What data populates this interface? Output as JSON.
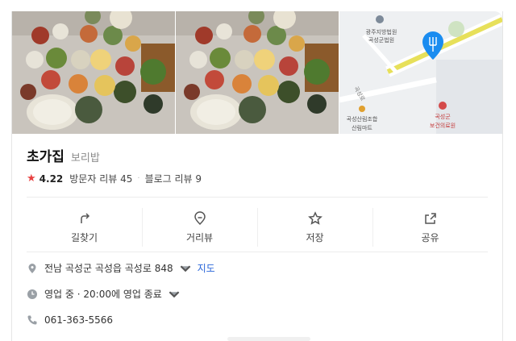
{
  "place": {
    "name": "초가집",
    "category": "보리밥",
    "rating": "4.22",
    "visitor_reviews": "방문자 리뷰 45",
    "blog_reviews": "블로그 리뷰 9"
  },
  "map": {
    "label_court": "광주지방법원",
    "label_court2": "곡성군법원",
    "label_road": "곡성로",
    "label_coop1": "곡성산림조합",
    "label_coop2": "산림마트",
    "label_clinic1": "곡성군",
    "label_clinic2": "보건의료원"
  },
  "actions": [
    {
      "label": "길찾기",
      "icon": "directions-icon"
    },
    {
      "label": "거리뷰",
      "icon": "streetview-icon"
    },
    {
      "label": "저장",
      "icon": "star-icon"
    },
    {
      "label": "공유",
      "icon": "share-icon"
    }
  ],
  "details": {
    "address": "전남 곡성군 곡성읍 곡성로 848",
    "map_link": "지도",
    "hours": "영업 중 · 20:00에 영업 종료",
    "phone": "061-363-5566"
  },
  "colors": {
    "accent": "#2a66d9",
    "star": "#e84141",
    "map_pin": "#1a8cf0"
  }
}
